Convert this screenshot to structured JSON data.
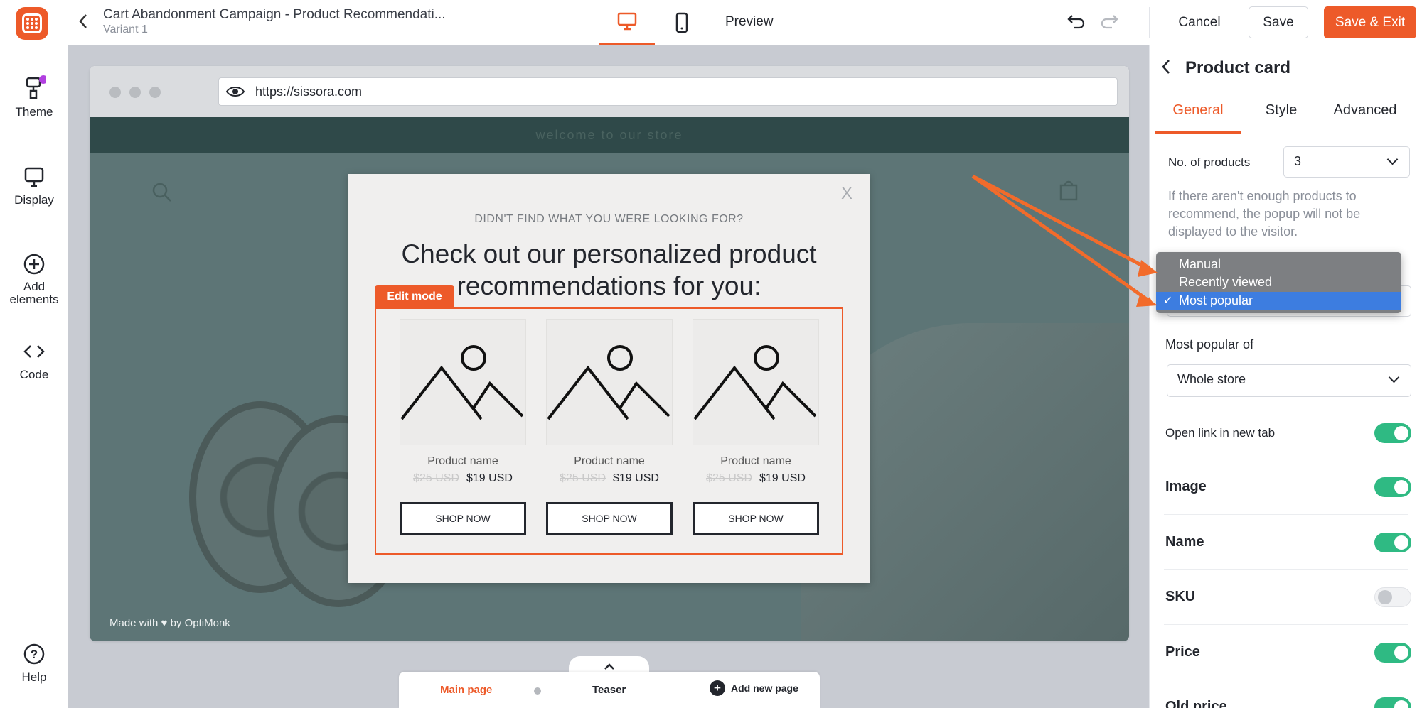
{
  "rail": {
    "theme": "Theme",
    "display": "Display",
    "add_elements": "Add elements",
    "code": "Code",
    "help": "Help"
  },
  "topbar": {
    "title": "Cart Abandonment Campaign - Product Recommendati...",
    "variant": "Variant 1",
    "preview": "Preview",
    "cancel": "Cancel",
    "save": "Save",
    "save_exit": "Save & Exit"
  },
  "browser": {
    "url": "https://sissora.com"
  },
  "site": {
    "banner": "welcome to our store",
    "made_with": "Made with ♥ by OptiMonk"
  },
  "popup": {
    "close": "X",
    "subtitle": "DIDN'T FIND WHAT YOU WERE LOOKING FOR?",
    "headline": "Check out our personalized product recommendations for you:",
    "edit_badge": "Edit mode",
    "cards": [
      {
        "name": "Product name",
        "old_price": "$25 USD",
        "price": "$19 USD",
        "button": "SHOP NOW"
      },
      {
        "name": "Product name",
        "old_price": "$25 USD",
        "price": "$19 USD",
        "button": "SHOP NOW"
      },
      {
        "name": "Product name",
        "old_price": "$25 USD",
        "price": "$19 USD",
        "button": "SHOP NOW"
      }
    ]
  },
  "pages": {
    "main": "Main page",
    "teaser": "Teaser",
    "add": "Add new page"
  },
  "panel": {
    "title": "Product card",
    "tabs": [
      "General",
      "Style",
      "Advanced"
    ],
    "no_products_label": "No. of products",
    "no_products_value": "3",
    "hint": "If there aren't enough products to recommend, the popup will not be displayed to the visitor.",
    "menu_options": [
      "Manual",
      "Recently viewed",
      "Most popular"
    ],
    "menu_selected": "Most popular",
    "check_mark": "✓",
    "most_popular_label": "Most popular of",
    "most_popular_value": "Whole store",
    "open_new_tab": "Open link in new tab",
    "toggles": [
      {
        "label": "Image",
        "on": true
      },
      {
        "label": "Name",
        "on": true
      },
      {
        "label": "SKU",
        "on": false
      },
      {
        "label": "Price",
        "on": true
      },
      {
        "label": "Old price",
        "on": true
      }
    ]
  },
  "colors": {
    "accent": "#ed5a29",
    "toggle_on": "#2fba83",
    "menu_highlight": "#3d7de0"
  }
}
